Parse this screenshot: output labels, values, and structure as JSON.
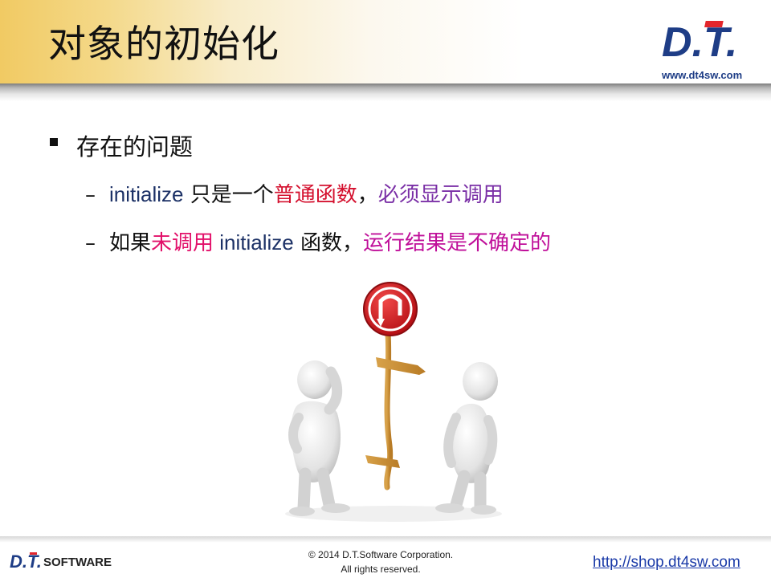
{
  "header": {
    "title": "对象的初始化",
    "logo_text": "D.T.",
    "logo_url": "www.dt4sw.com"
  },
  "content": {
    "bullet": "存在的问题",
    "sub1": {
      "dash": "–",
      "code": "initialize",
      "text1": " 只是一个",
      "em1": "普通函数",
      "sep": "，",
      "em2": "必须显示调用"
    },
    "sub2": {
      "dash": "–",
      "text1": "如果",
      "em1": "未调用",
      "code": " initialize",
      "text2": " 函数，",
      "em2": "运行结果是不确定的"
    }
  },
  "footer": {
    "logo_text": "D.T.",
    "logo_sub": "SOFTWARE",
    "copyright1": "© 2014 D.T.Software Corporation.",
    "copyright2": "All rights reserved.",
    "url": "http://shop.dt4sw.com"
  },
  "colors": {
    "header_gold": "#f1ca63",
    "brand_blue": "#1e3d86",
    "accent_red": "#d4102e",
    "accent_purple": "#7a2fa6",
    "accent_pink": "#e2106a",
    "accent_magenta": "#c0109a",
    "code_navy": "#1c3166"
  }
}
